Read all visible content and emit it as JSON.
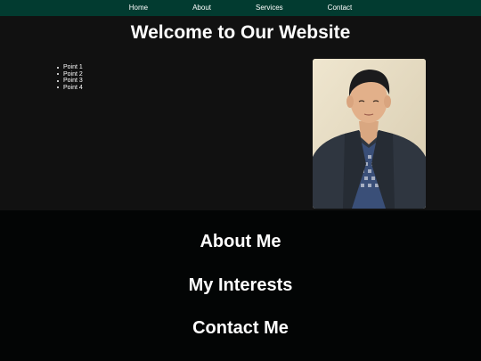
{
  "nav": {
    "items": [
      "Home",
      "About",
      "Services",
      "Contact"
    ]
  },
  "hero": {
    "title": "Welcome to Our Website",
    "points": [
      "Point 1",
      "Point 2",
      "Point 3",
      "Point 4"
    ],
    "photo_icon": "person-portrait-photo"
  },
  "sections": {
    "about": "About Me",
    "interests": "My Interests",
    "contact": "Contact Me"
  },
  "colors": {
    "navbar": "#023b30",
    "hero_background": "#111111",
    "page_background": "#030505",
    "text": "#ffffff"
  }
}
